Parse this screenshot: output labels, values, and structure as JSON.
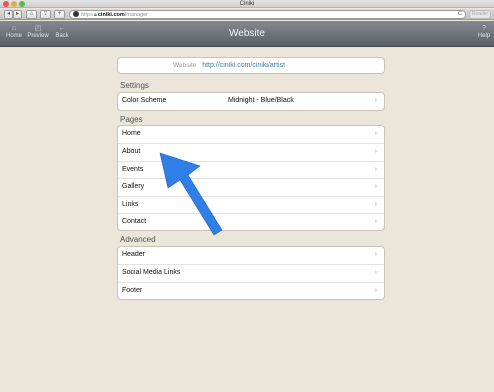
{
  "window": {
    "title": "Ciniki"
  },
  "toolbar": {
    "back": "◂",
    "forward": "▸",
    "home": "⌂",
    "share": "⇪",
    "add": "+",
    "address": {
      "protocol": "https",
      "host": "ciniki.com",
      "path": "/manager"
    },
    "reload": "C",
    "reader": "Reader"
  },
  "appbar": {
    "title": "Website",
    "home_label": "Home",
    "preview_label": "Preview",
    "back_label": "Back",
    "help_label": "Help",
    "home_icon": "⌂",
    "preview_icon": "◰",
    "back_icon": "←",
    "help_icon": "?"
  },
  "website": {
    "label": "Website",
    "url": "http://ciniki.com/ciniki/artist"
  },
  "settings": {
    "heading": "Settings",
    "items": [
      {
        "label": "Color Scheme",
        "value": "Midnight - Blue/Black"
      }
    ]
  },
  "pages": {
    "heading": "Pages",
    "items": [
      {
        "label": "Home"
      },
      {
        "label": "About"
      },
      {
        "label": "Events"
      },
      {
        "label": "Gallery"
      },
      {
        "label": "Links"
      },
      {
        "label": "Contact"
      }
    ]
  },
  "advanced": {
    "heading": "Advanced",
    "items": [
      {
        "label": "Header"
      },
      {
        "label": "Social Media Links"
      },
      {
        "label": "Footer"
      }
    ]
  },
  "chevron": "›",
  "colors": {
    "accent_link": "#3f7fa8",
    "annotation_arrow": "#2f7fe6",
    "navbar": "#6c7177"
  }
}
